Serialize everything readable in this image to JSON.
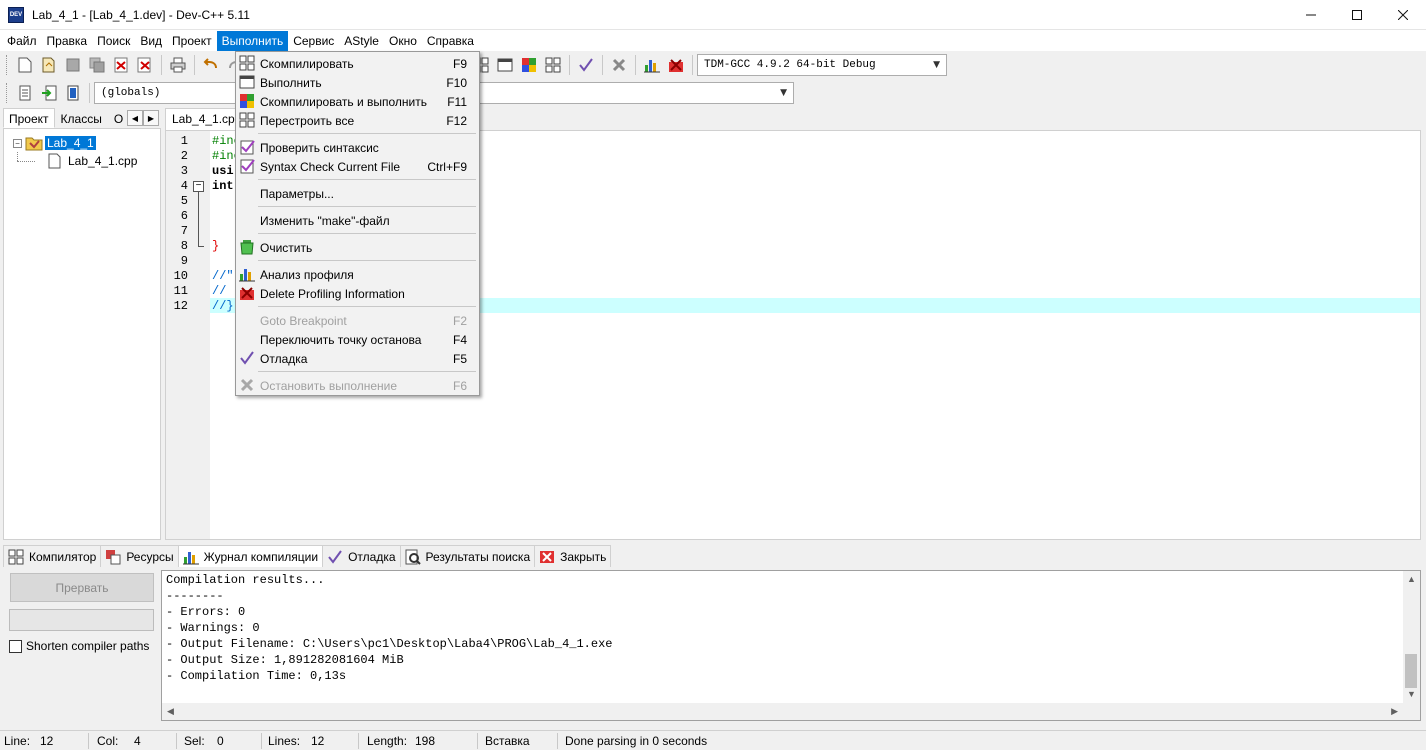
{
  "window": {
    "title": "Lab_4_1 - [Lab_4_1.dev] - Dev-C++ 5.11",
    "icon_text": "DEV",
    "controls": [
      "minimize-icon",
      "maximize-icon",
      "close-icon"
    ]
  },
  "menubar": [
    "Файл",
    "Правка",
    "Поиск",
    "Вид",
    "Проект",
    "Выполнить",
    "Сервис",
    "AStyle",
    "Окно",
    "Справка"
  ],
  "toolbar": {
    "compiler_select": "TDM-GCC 4.9.2 64-bit Debug",
    "scope_select": "(globals)"
  },
  "left_panel": {
    "tabs": [
      "Проект",
      "Классы",
      "О"
    ],
    "project_name": "Lab_4_1",
    "file_name": "Lab_4_1.cpp"
  },
  "editor": {
    "tab_label": "Lab_4_1.cpp",
    "line_numbers": [
      "1",
      "2",
      "3",
      "4",
      "5",
      "6",
      "7",
      "8",
      "9",
      "10",
      "11",
      "12"
    ],
    "code": {
      "l1": "#inc",
      "l2": "#inc",
      "l3": "usi",
      "l4": "int",
      "l8": "}",
      "l10": "//\"",
      "l11": "//",
      "l12": "//}"
    }
  },
  "run_menu": {
    "compile": {
      "label": "Скомпилировать",
      "shortcut": "F9"
    },
    "run": {
      "label": "Выполнить",
      "shortcut": "F10"
    },
    "compile_run": {
      "label": "Скомпилировать и выполнить",
      "shortcut": "F11"
    },
    "rebuild": {
      "label": "Перестроить все",
      "shortcut": "F12"
    },
    "syntax": {
      "label": "Проверить синтаксис",
      "shortcut": ""
    },
    "syntax_file": {
      "label": "Syntax Check Current File",
      "shortcut": "Ctrl+F9"
    },
    "params": {
      "label": "Параметры...",
      "shortcut": ""
    },
    "makefile": {
      "label": "Изменить \"make\"-файл",
      "shortcut": ""
    },
    "clean": {
      "label": "Очистить",
      "shortcut": ""
    },
    "profile": {
      "label": "Анализ профиля",
      "shortcut": ""
    },
    "delete_profile": {
      "label": "Delete Profiling Information",
      "shortcut": ""
    },
    "goto_bp": {
      "label": "Goto Breakpoint",
      "shortcut": "F2"
    },
    "toggle_bp": {
      "label": "Переключить точку останова",
      "shortcut": "F4"
    },
    "debug": {
      "label": "Отладка",
      "shortcut": "F5"
    },
    "stop": {
      "label": "Остановить выполнение",
      "shortcut": "F6"
    }
  },
  "bottom_tabs": [
    "Компилятор",
    "Ресурсы",
    "Журнал компиляции",
    "Отладка",
    "Результаты поиска",
    "Закрыть"
  ],
  "bottom_left": {
    "abort_label": "Прервать",
    "shorten_label": "Shorten compiler paths"
  },
  "log_lines": [
    "Compilation results...",
    "--------",
    "- Errors: 0",
    "- Warnings: 0",
    "- Output Filename: C:\\Users\\pc1\\Desktop\\Laba4\\PROG\\Lab_4_1.exe",
    "- Output Size: 1,891282081604 MiB",
    "- Compilation Time: 0,13s"
  ],
  "statusbar": {
    "line_label": "Line:",
    "line_val": "12",
    "col_label": "Col:",
    "col_val": "4",
    "sel_label": "Sel:",
    "sel_val": "0",
    "lines_label": "Lines:",
    "lines_val": "12",
    "length_label": "Length:",
    "length_val": "198",
    "mode": "Вставка",
    "message": "Done parsing in 0 seconds"
  }
}
